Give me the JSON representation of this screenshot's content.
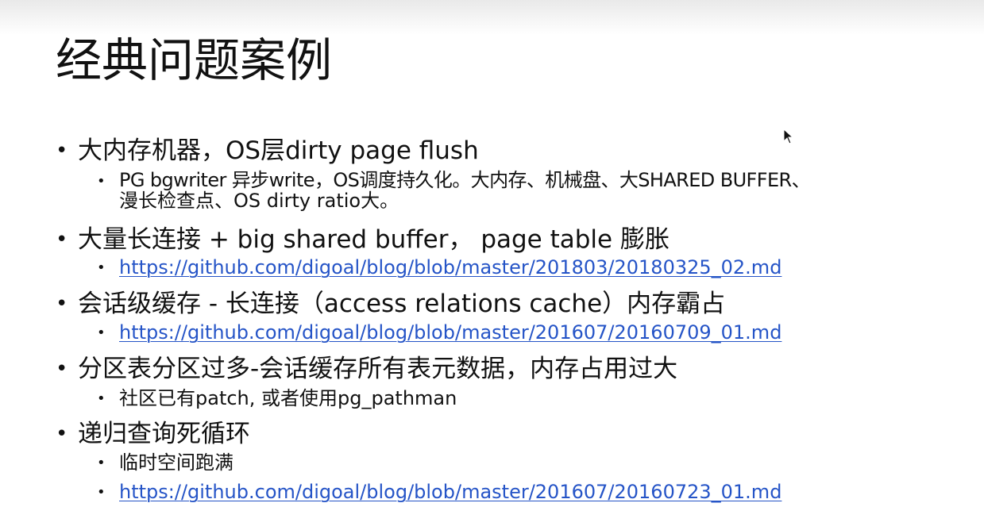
{
  "slide": {
    "title": "经典问题案例",
    "items": [
      {
        "text": "大内存机器，OS层dirty page flush",
        "sub": [
          {
            "line1": "PG bgwriter 异步write，OS调度持久化。大内存、机械盘、大SHARED BUFFER、",
            "line2": "漫长检查点、OS dirty ratio大。"
          }
        ]
      },
      {
        "text": "大量长连接 + big shared buffer， page table 膨胀",
        "sub": [
          {
            "link": "https://github.com/digoal/blog/blob/master/201803/20180325_02.md"
          }
        ]
      },
      {
        "text": "会话级缓存 - 长连接（access relations cache）内存霸占",
        "sub": [
          {
            "link": "https://github.com/digoal/blog/blob/master/201607/20160709_01.md"
          }
        ]
      },
      {
        "text": "分区表分区过多-会话缓存所有表元数据，内存占用过大",
        "sub": [
          {
            "text": "社区已有patch, 或者使用pg_pathman"
          }
        ]
      },
      {
        "text": "递归查询死循环",
        "sub": [
          {
            "text": "临时空间跑满"
          },
          {
            "link": "https://github.com/digoal/blog/blob/master/201607/20160723_01.md"
          }
        ]
      }
    ]
  },
  "bullet": "•",
  "colors": {
    "text": "#111111",
    "link": "#2554c7",
    "background": "#ffffff"
  },
  "icons": {
    "cursor": "mouse-pointer-icon"
  }
}
